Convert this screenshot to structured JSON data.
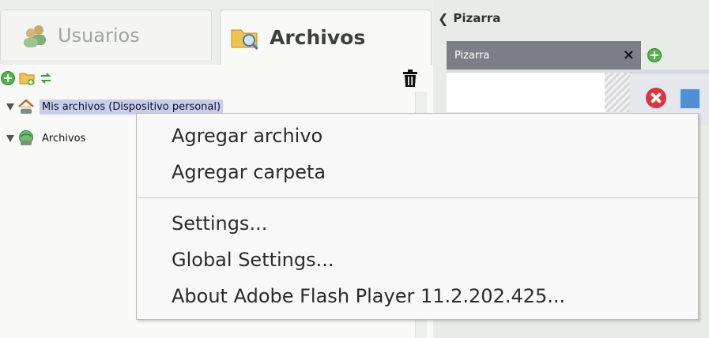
{
  "left_panel": {
    "tabs": [
      {
        "label": "Usuarios",
        "active": false,
        "icon": "users-icon"
      },
      {
        "label": "Archivos",
        "active": true,
        "icon": "folder-search-icon"
      }
    ],
    "toolbar": {
      "icons": [
        "add-file-icon",
        "add-folder-icon",
        "refresh-icon",
        "trash-icon"
      ]
    },
    "tree": [
      {
        "label": "Mis archivos (Dispositivo personal)",
        "icon": "home-drive-icon",
        "selected": true
      },
      {
        "label": "Archivos",
        "icon": "network-drive-icon",
        "selected": false
      }
    ]
  },
  "right_panel": {
    "title": "Pizarra",
    "tab": {
      "label": "Pizarra",
      "close": "×"
    },
    "colors": {
      "tab_bg": "#7d7f86",
      "delete": "#d9363e"
    }
  },
  "context_menu": {
    "items": [
      "Agregar archivo",
      "Agregar carpeta",
      "Settings...",
      "Global Settings...",
      "About Adobe Flash Player 11.2.202.425..."
    ]
  }
}
